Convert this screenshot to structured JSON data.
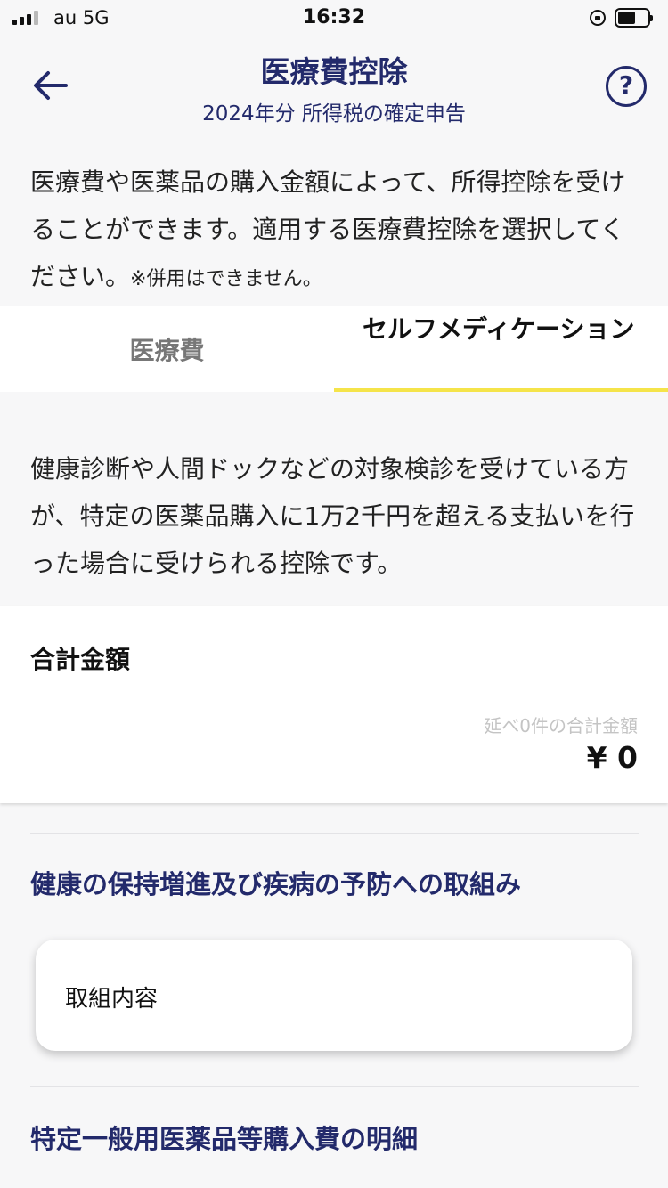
{
  "status_bar": {
    "carrier": "au  5G",
    "time": "16:32"
  },
  "header": {
    "title": "医療費控除",
    "subtitle": "2024年分 所得税の確定申告",
    "help_label": "?"
  },
  "intro": {
    "text": "医療費や医薬品の購入金額によって、所得控除を受けることができます。適用する医療費控除を選択してください。",
    "note": "※併用はできません。"
  },
  "tabs": [
    {
      "label": "医療費",
      "selected": false
    },
    {
      "label": "セルフメディケーション",
      "selected": true
    }
  ],
  "description": "健康診断や人間ドックなどの対象検診を受けている方が、特定の医薬品購入に1万2千円を超える支払いを行った場合に受けられる控除です。",
  "total": {
    "title": "合計金額",
    "count_label": "延べ0件の合計金額",
    "amount": "¥ 0"
  },
  "sections": {
    "health_effort": {
      "title": "健康の保持増進及び疾病の予防への取組み",
      "item_label": "取組内容"
    },
    "otc_purchase": {
      "title": "特定一般用医薬品等購入費の明細"
    }
  },
  "colors": {
    "brand_navy": "#232a6b",
    "tab_indicator": "#f5e44a",
    "background": "#f7f7f8"
  }
}
